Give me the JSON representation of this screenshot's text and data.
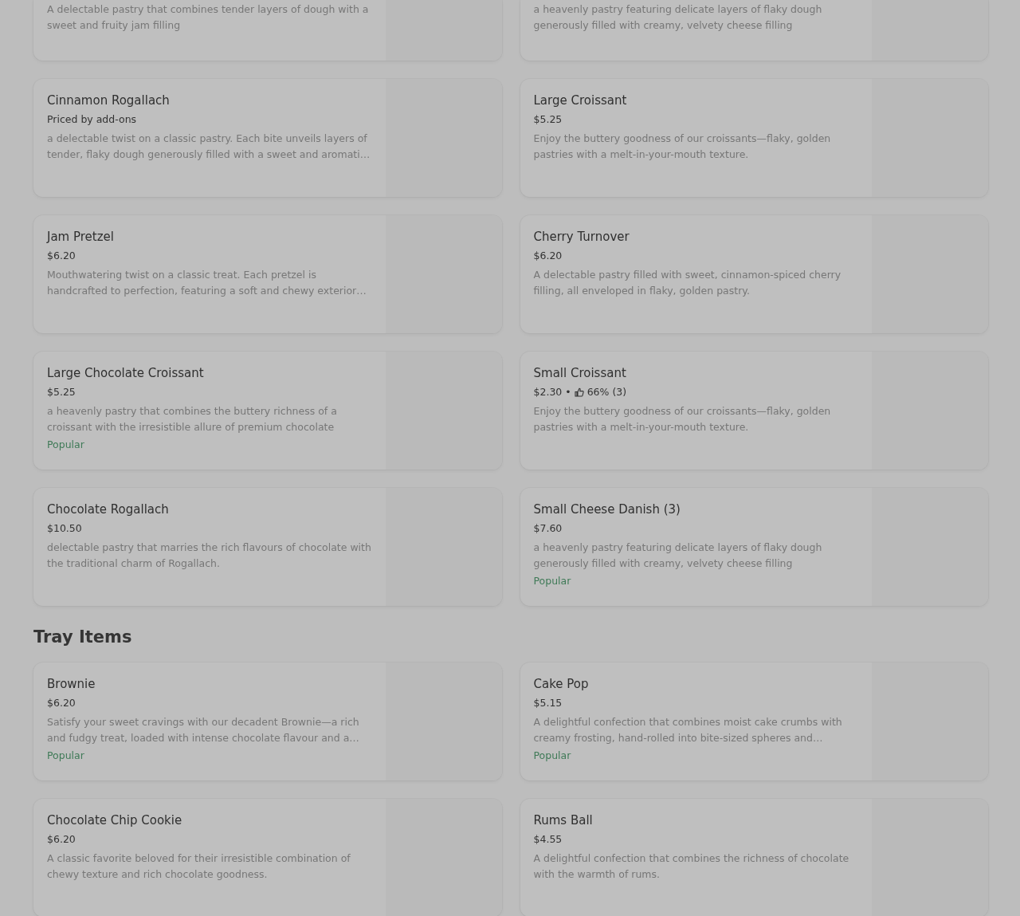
{
  "sections": [
    {
      "items": [
        {
          "description": "A delectable pastry that combines tender layers of dough with a sweet and fruity jam filling"
        },
        {
          "description": "a heavenly pastry featuring delicate layers of flaky dough generously filled with creamy, velvety cheese filling"
        },
        {
          "name": "Cinnamon Rogallach",
          "price": "Priced by add-ons",
          "description": "a delectable twist on a classic pastry. Each bite unveils layers of tender, flaky dough generously filled with a sweet and aromati…"
        },
        {
          "name": "Large Croissant",
          "price": "$5.25",
          "description": "Enjoy the buttery goodness of our croissants—flaky, golden pastries with a melt-in-your-mouth texture."
        },
        {
          "name": "Jam Pretzel",
          "price": "$6.20",
          "description": "Mouthwatering twist on a classic treat. Each pretzel is handcrafted to perfection, featuring a soft and chewy exterior…"
        },
        {
          "name": "Cherry Turnover",
          "price": "$6.20",
          "description": "A delectable pastry filled with sweet, cinnamon-spiced cherry filling, all enveloped in flaky, golden pastry."
        },
        {
          "name": "Large Chocolate Croissant",
          "price": "$5.25",
          "description": "a heavenly pastry that combines the buttery richness of a croissant with the irresistible allure of premium chocolate",
          "badge": "Popular"
        },
        {
          "name": "Small Croissant",
          "price": "$2.30",
          "separator": "•",
          "rating": "66% (3)",
          "description": "Enjoy the buttery goodness of our croissants—flaky, golden pastries with a melt-in-your-mouth texture."
        },
        {
          "name": "Chocolate Rogallach",
          "price": "$10.50",
          "description": "delectable pastry that marries the rich flavours of chocolate with the traditional charm of Rogallach."
        },
        {
          "name": "Small Cheese Danish (3)",
          "price": "$7.60",
          "description": "a heavenly pastry featuring delicate layers of flaky dough generously filled with creamy, velvety cheese filling",
          "badge": "Popular"
        }
      ]
    },
    {
      "title": "Tray Items",
      "items": [
        {
          "name": "Brownie",
          "price": "$6.20",
          "description": "Satisfy your sweet cravings with our decadent Brownie—a rich and fudgy treat, loaded with intense chocolate flavour and a…",
          "badge": "Popular"
        },
        {
          "name": "Cake Pop",
          "price": "$5.15",
          "description": "A delightful confection that combines moist cake crumbs with creamy frosting, hand-rolled into bite-sized spheres and…",
          "badge": "Popular"
        },
        {
          "name": "Chocolate Chip Cookie",
          "price": "$6.20",
          "description": "A classic favorite beloved for their irresistible combination of chewy texture and rich chocolate goodness."
        },
        {
          "name": "Rums Ball",
          "price": "$4.55",
          "description": "A delightful confection that combines the richness of chocolate with the warmth of rums."
        }
      ]
    }
  ]
}
